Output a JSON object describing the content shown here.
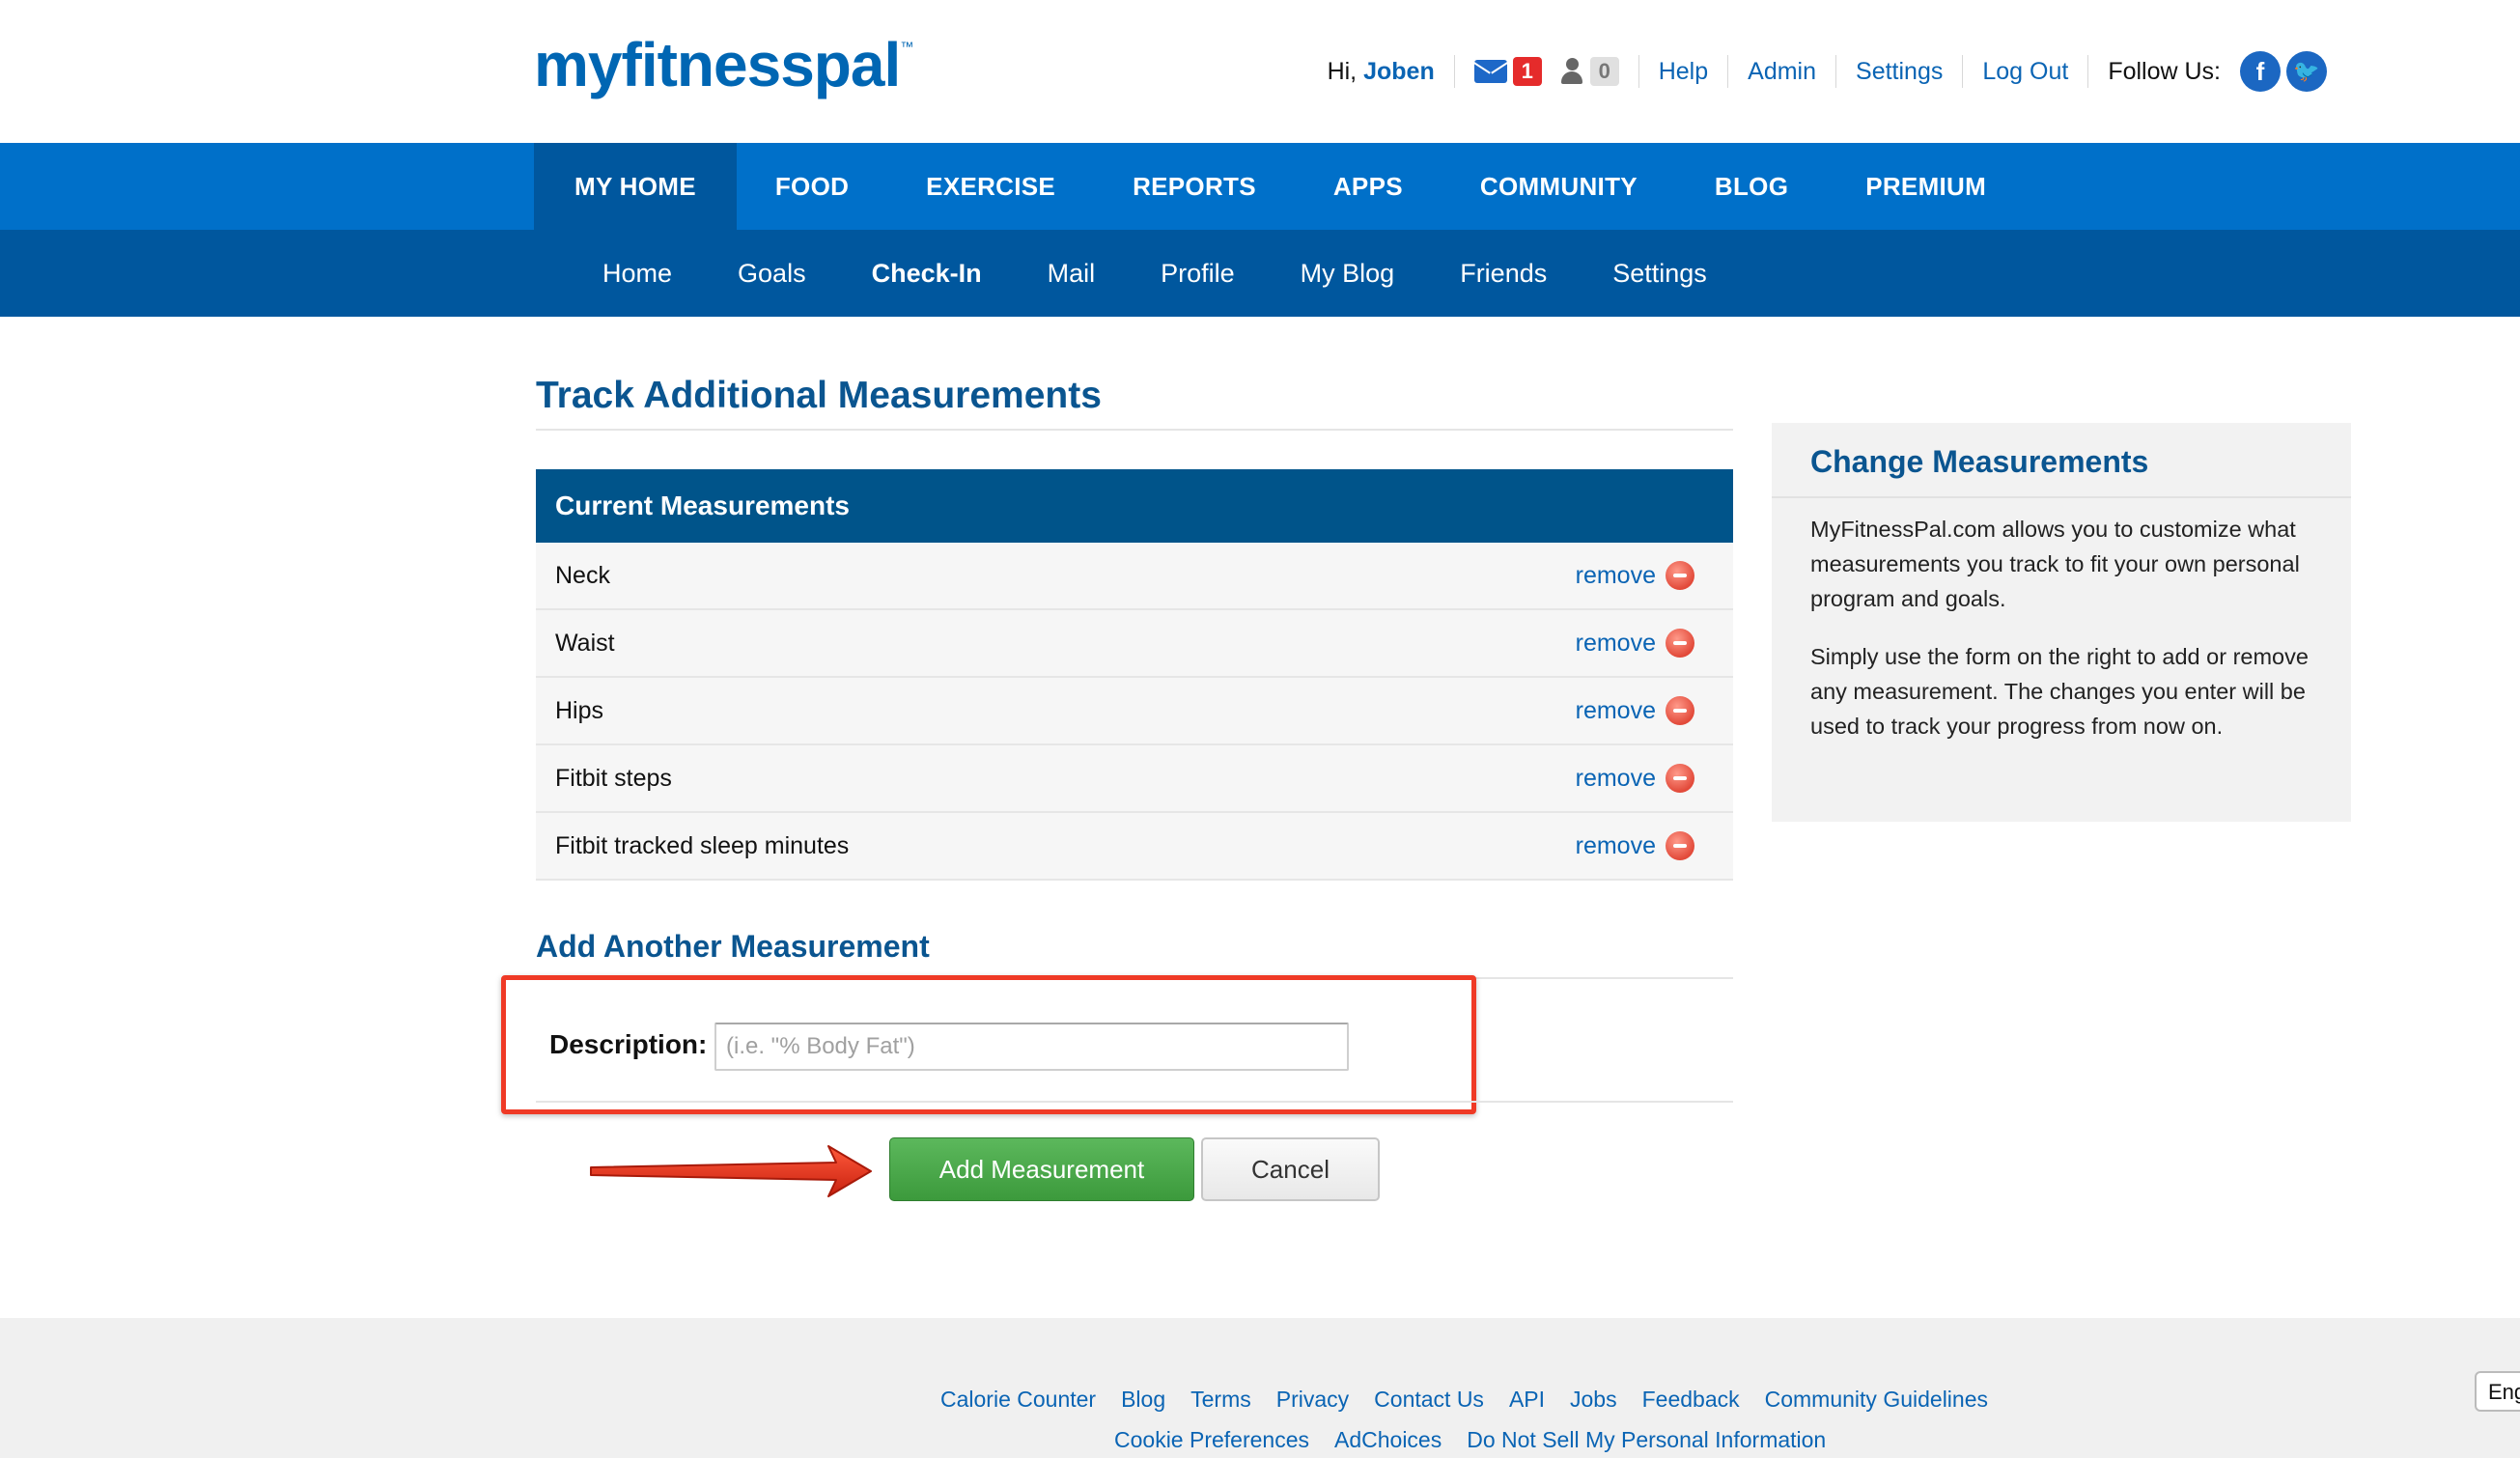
{
  "header": {
    "logo": "myfitnesspal",
    "logo_tm": "™",
    "greeting": "Hi,",
    "username": "Joben",
    "mail_count": "1",
    "friend_count": "0",
    "links": {
      "help": "Help",
      "admin": "Admin",
      "settings": "Settings",
      "logout": "Log Out"
    },
    "follow_label": "Follow Us:",
    "facebook_glyph": "f",
    "twitter_glyph": "🐦"
  },
  "main_nav": {
    "items": [
      {
        "label": "MY HOME"
      },
      {
        "label": "FOOD"
      },
      {
        "label": "EXERCISE"
      },
      {
        "label": "REPORTS"
      },
      {
        "label": "APPS"
      },
      {
        "label": "COMMUNITY"
      },
      {
        "label": "BLOG"
      },
      {
        "label": "PREMIUM"
      }
    ]
  },
  "sub_nav": {
    "items": [
      {
        "label": "Home"
      },
      {
        "label": "Goals"
      },
      {
        "label": "Check-In"
      },
      {
        "label": "Mail"
      },
      {
        "label": "Profile"
      },
      {
        "label": "My Blog"
      },
      {
        "label": "Friends"
      },
      {
        "label": "Settings"
      }
    ]
  },
  "page": {
    "title": "Track Additional Measurements",
    "current_header": "Current Measurements",
    "remove_label": "remove",
    "measurements": [
      {
        "name": "Neck"
      },
      {
        "name": "Waist"
      },
      {
        "name": "Hips"
      },
      {
        "name": "Fitbit steps"
      },
      {
        "name": "Fitbit tracked sleep minutes"
      }
    ],
    "add_title": "Add Another Measurement",
    "description_label": "Description:",
    "description_placeholder": "(i.e. \"% Body Fat\")",
    "description_value": "",
    "add_button": "Add Measurement",
    "cancel_button": "Cancel"
  },
  "sidebar": {
    "title": "Change Measurements",
    "p1": "MyFitnessPal.com allows you to customize what measurements you track to fit your own personal program and goals.",
    "p2": "Simply use the form on the right to add or remove any measurement. The changes you enter will be used to track your progress from now on."
  },
  "footer": {
    "row1": [
      "Calorie Counter",
      "Blog",
      "Terms",
      "Privacy",
      "Contact Us",
      "API",
      "Jobs",
      "Feedback",
      "Community Guidelines"
    ],
    "row2": [
      "Cookie Preferences",
      "AdChoices",
      "Do Not Sell My Personal Information"
    ],
    "lang": "Eng"
  },
  "colors": {
    "brand_blue": "#0070c9",
    "nav_dark": "#00579e",
    "title_blue": "#0a5590",
    "add_green": "#4cae4c",
    "annotation_red": "#ef3a26"
  }
}
